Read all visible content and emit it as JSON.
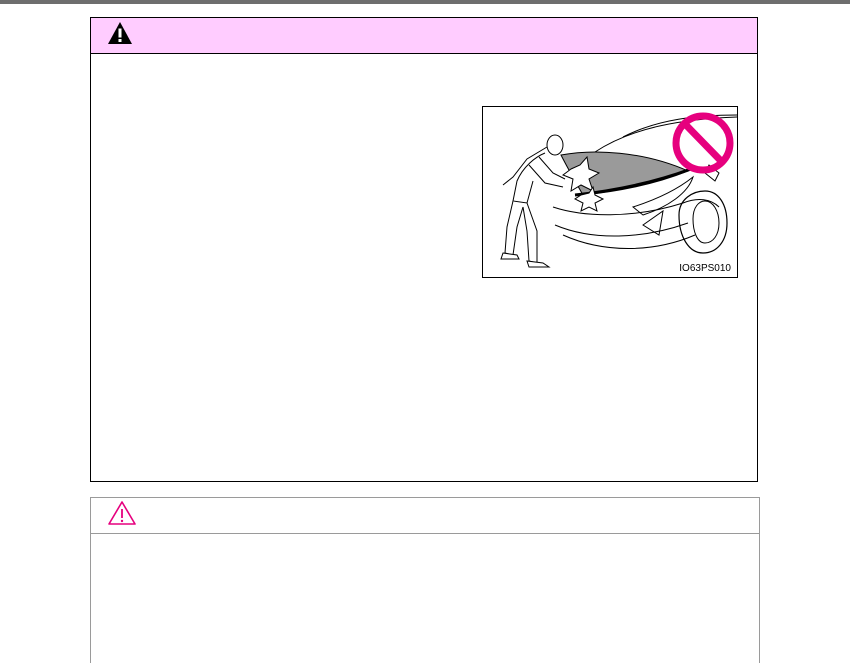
{
  "warning": {
    "header_color": "#ffccff",
    "icon": "warning-triangle-icon"
  },
  "figure": {
    "code": "IO63PS010",
    "prohibition_color": "#e6007e",
    "icon": "prohibition-icon"
  },
  "notice": {
    "icon": "caution-triangle-outline-icon",
    "icon_color": "#e6007e"
  }
}
